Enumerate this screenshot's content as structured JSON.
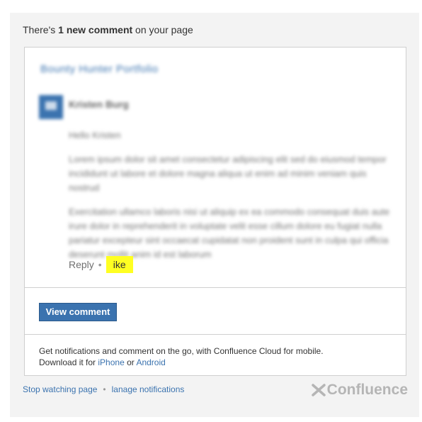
{
  "header": {
    "prefix": "There's ",
    "highlight": "1 new comment",
    "suffix": " on your page"
  },
  "card": {
    "page_link": "Bounty Hunter Portfolio",
    "author": "Kristen Burg",
    "comment_paragraphs": [
      "Hello Kristen",
      "Lorem ipsum dolor sit amet consectetur adipiscing elit sed do eiusmod tempor incididunt ut labore et dolore magna aliqua ut enim ad minim veniam quis nostrud",
      "Exercitation ullamco laboris nisi ut aliquip ex ea commodo consequat duis aute irure dolor in reprehenderit in voluptate velit esse cillum dolore eu fugiat nulla pariatur excepteur sint occaecat cupidatat non proident sunt in culpa qui officia deserunt mollit anim id est laborum"
    ],
    "reply_label": "Reply",
    "like_label": "ike",
    "view_comment_label": "View comment",
    "mobile_line1": "Get notifications and comment on the go, with Confluence Cloud for mobile.",
    "mobile_line2_prefix": "Download it for ",
    "iphone_label": "iPhone",
    "mobile_or": " or ",
    "android_label": "Android"
  },
  "footer": {
    "stop_watching_label": "Stop watching page",
    "manage_notifications_label": "lanage notifications",
    "logo_text": "Confluence"
  },
  "colors": {
    "accent": "#3b73af",
    "like_highlight": "#ffff22",
    "background": "#f3f3f3"
  }
}
